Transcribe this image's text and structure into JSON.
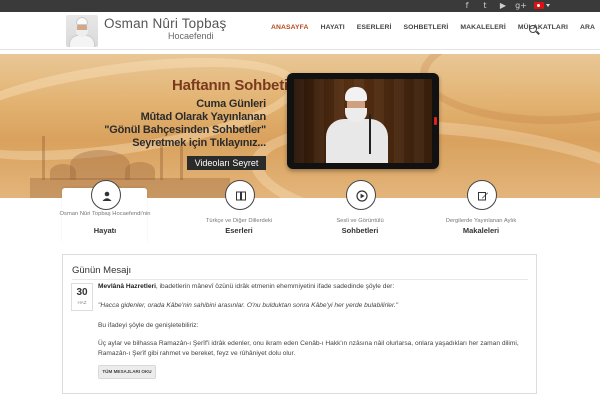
{
  "topbar": {
    "social_icons": [
      "facebook-icon",
      "twitter-icon",
      "youtube-icon",
      "google-plus-icon",
      "instagram-icon"
    ],
    "social_glyphs": [
      "f",
      "t",
      "▶",
      "g+",
      "◎"
    ],
    "language_flag": "turkey-flag-icon"
  },
  "header": {
    "logo_name": "Osman Nûri Topbaş",
    "logo_sub": "Hocaefendi",
    "nav": [
      "ANASAYFA",
      "HAYATI",
      "ESERLERİ",
      "SOHBETLERİ",
      "MAKALELERİ",
      "MÜLAKATLARI",
      "ARA"
    ],
    "active_color": "#b54a1e"
  },
  "hero": {
    "title": "Haftanın Sohbeti",
    "lines": [
      "Cuma Günleri",
      "Mûtad Olarak Yayınlanan",
      "\"Gönül Bahçesinden Sohbetler\"",
      "Seyretmek için Tıklayınız..."
    ],
    "button": "Videoları Seyret"
  },
  "features": [
    {
      "sub": "Osman Nûri Topbaş Hocaefendi'nin",
      "title": "Hayatı",
      "icon": "user-icon"
    },
    {
      "sub": "Türkçe ve Diğer Dillerdeki",
      "title": "Eserleri",
      "icon": "book-icon"
    },
    {
      "sub": "Sesli ve Görüntülü",
      "title": "Sohbetleri",
      "icon": "play-icon"
    },
    {
      "sub": "Dergilerde Yayınlanan Aylık",
      "title": "Makaleleri",
      "icon": "edit-icon"
    }
  ],
  "message": {
    "title": "Günün Mesajı",
    "day": "30",
    "month": "HAZ",
    "author": "Mevlânâ Hazretleri",
    "p1_rest": ", ibadetlerin mânevî özünü idrâk etmenin ehemmiyetini ifade sadedinde şöyle der:",
    "quote": "\"Hacca gidenler, orada Kâbe'nin sahibini arasınlar. O'nu bulduktan sonra Kâbe'yi her yerde bulabilirler.\"",
    "p3": "Bu ifadeyi şöyle de genişletebiliriz:",
    "p4": "Üç aylar ve bilhassa Ramazân-ı Şerîf'i idrâk edenler, onu ikram eden Cenâb-ı Hakk'ın nzâsına nâil olurlarsa, onlara yaşadıkları her zaman dilimi, Ramazân-ı Şerîf gibi rahmet ve bereket, feyz ve rûhâniyet dolu olur.",
    "button": "TÜM MESAJLARI OKU"
  }
}
